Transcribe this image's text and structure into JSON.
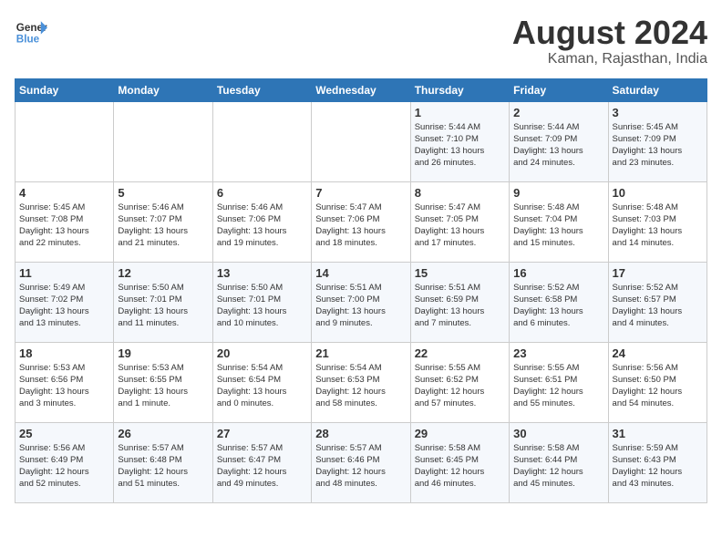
{
  "logo": {
    "line1": "General",
    "line2": "Blue"
  },
  "title": {
    "month_year": "August 2024",
    "location": "Kaman, Rajasthan, India"
  },
  "days_of_week": [
    "Sunday",
    "Monday",
    "Tuesday",
    "Wednesday",
    "Thursday",
    "Friday",
    "Saturday"
  ],
  "weeks": [
    [
      {
        "day": "",
        "info": ""
      },
      {
        "day": "",
        "info": ""
      },
      {
        "day": "",
        "info": ""
      },
      {
        "day": "",
        "info": ""
      },
      {
        "day": "1",
        "info": "Sunrise: 5:44 AM\nSunset: 7:10 PM\nDaylight: 13 hours\nand 26 minutes."
      },
      {
        "day": "2",
        "info": "Sunrise: 5:44 AM\nSunset: 7:09 PM\nDaylight: 13 hours\nand 24 minutes."
      },
      {
        "day": "3",
        "info": "Sunrise: 5:45 AM\nSunset: 7:09 PM\nDaylight: 13 hours\nand 23 minutes."
      }
    ],
    [
      {
        "day": "4",
        "info": "Sunrise: 5:45 AM\nSunset: 7:08 PM\nDaylight: 13 hours\nand 22 minutes."
      },
      {
        "day": "5",
        "info": "Sunrise: 5:46 AM\nSunset: 7:07 PM\nDaylight: 13 hours\nand 21 minutes."
      },
      {
        "day": "6",
        "info": "Sunrise: 5:46 AM\nSunset: 7:06 PM\nDaylight: 13 hours\nand 19 minutes."
      },
      {
        "day": "7",
        "info": "Sunrise: 5:47 AM\nSunset: 7:06 PM\nDaylight: 13 hours\nand 18 minutes."
      },
      {
        "day": "8",
        "info": "Sunrise: 5:47 AM\nSunset: 7:05 PM\nDaylight: 13 hours\nand 17 minutes."
      },
      {
        "day": "9",
        "info": "Sunrise: 5:48 AM\nSunset: 7:04 PM\nDaylight: 13 hours\nand 15 minutes."
      },
      {
        "day": "10",
        "info": "Sunrise: 5:48 AM\nSunset: 7:03 PM\nDaylight: 13 hours\nand 14 minutes."
      }
    ],
    [
      {
        "day": "11",
        "info": "Sunrise: 5:49 AM\nSunset: 7:02 PM\nDaylight: 13 hours\nand 13 minutes."
      },
      {
        "day": "12",
        "info": "Sunrise: 5:50 AM\nSunset: 7:01 PM\nDaylight: 13 hours\nand 11 minutes."
      },
      {
        "day": "13",
        "info": "Sunrise: 5:50 AM\nSunset: 7:01 PM\nDaylight: 13 hours\nand 10 minutes."
      },
      {
        "day": "14",
        "info": "Sunrise: 5:51 AM\nSunset: 7:00 PM\nDaylight: 13 hours\nand 9 minutes."
      },
      {
        "day": "15",
        "info": "Sunrise: 5:51 AM\nSunset: 6:59 PM\nDaylight: 13 hours\nand 7 minutes."
      },
      {
        "day": "16",
        "info": "Sunrise: 5:52 AM\nSunset: 6:58 PM\nDaylight: 13 hours\nand 6 minutes."
      },
      {
        "day": "17",
        "info": "Sunrise: 5:52 AM\nSunset: 6:57 PM\nDaylight: 13 hours\nand 4 minutes."
      }
    ],
    [
      {
        "day": "18",
        "info": "Sunrise: 5:53 AM\nSunset: 6:56 PM\nDaylight: 13 hours\nand 3 minutes."
      },
      {
        "day": "19",
        "info": "Sunrise: 5:53 AM\nSunset: 6:55 PM\nDaylight: 13 hours\nand 1 minute."
      },
      {
        "day": "20",
        "info": "Sunrise: 5:54 AM\nSunset: 6:54 PM\nDaylight: 13 hours\nand 0 minutes."
      },
      {
        "day": "21",
        "info": "Sunrise: 5:54 AM\nSunset: 6:53 PM\nDaylight: 12 hours\nand 58 minutes."
      },
      {
        "day": "22",
        "info": "Sunrise: 5:55 AM\nSunset: 6:52 PM\nDaylight: 12 hours\nand 57 minutes."
      },
      {
        "day": "23",
        "info": "Sunrise: 5:55 AM\nSunset: 6:51 PM\nDaylight: 12 hours\nand 55 minutes."
      },
      {
        "day": "24",
        "info": "Sunrise: 5:56 AM\nSunset: 6:50 PM\nDaylight: 12 hours\nand 54 minutes."
      }
    ],
    [
      {
        "day": "25",
        "info": "Sunrise: 5:56 AM\nSunset: 6:49 PM\nDaylight: 12 hours\nand 52 minutes."
      },
      {
        "day": "26",
        "info": "Sunrise: 5:57 AM\nSunset: 6:48 PM\nDaylight: 12 hours\nand 51 minutes."
      },
      {
        "day": "27",
        "info": "Sunrise: 5:57 AM\nSunset: 6:47 PM\nDaylight: 12 hours\nand 49 minutes."
      },
      {
        "day": "28",
        "info": "Sunrise: 5:57 AM\nSunset: 6:46 PM\nDaylight: 12 hours\nand 48 minutes."
      },
      {
        "day": "29",
        "info": "Sunrise: 5:58 AM\nSunset: 6:45 PM\nDaylight: 12 hours\nand 46 minutes."
      },
      {
        "day": "30",
        "info": "Sunrise: 5:58 AM\nSunset: 6:44 PM\nDaylight: 12 hours\nand 45 minutes."
      },
      {
        "day": "31",
        "info": "Sunrise: 5:59 AM\nSunset: 6:43 PM\nDaylight: 12 hours\nand 43 minutes."
      }
    ]
  ]
}
